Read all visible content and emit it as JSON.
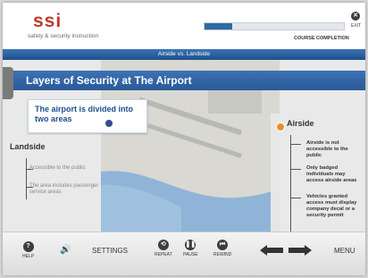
{
  "header": {
    "logo_text": "ssi",
    "tagline": "safety & security instruction",
    "progress_label": "COURSE COMPLETION",
    "progress_fraction": 0.2,
    "exit_label": "EXIT"
  },
  "section_title": "Airside vs. Landside",
  "page_title": "Layers of Security at The Airport",
  "callout_text": "The airport is divided into two areas",
  "landside": {
    "title": "Landside",
    "items": [
      "Accessible to the public",
      "The area includes passenger service areas"
    ]
  },
  "airside": {
    "title": "Airside",
    "items": [
      "Airside is not accessible to the public",
      "Only badged individuals may access airside areas",
      "Vehicles granted access must display company decal or a security permit"
    ]
  },
  "footer": {
    "help_label": "HELP",
    "settings_label": "SETTINGS",
    "repeat_label": "REPEAT",
    "pause_label": "PAUSE",
    "rewind_label": "REWIND",
    "menu_label": "MENU"
  },
  "colors": {
    "accent_blue": "#2a5a98",
    "airside_dot": "#e6902a",
    "landside_dot": "#2c4f8f",
    "logo_red": "#c0392b"
  }
}
